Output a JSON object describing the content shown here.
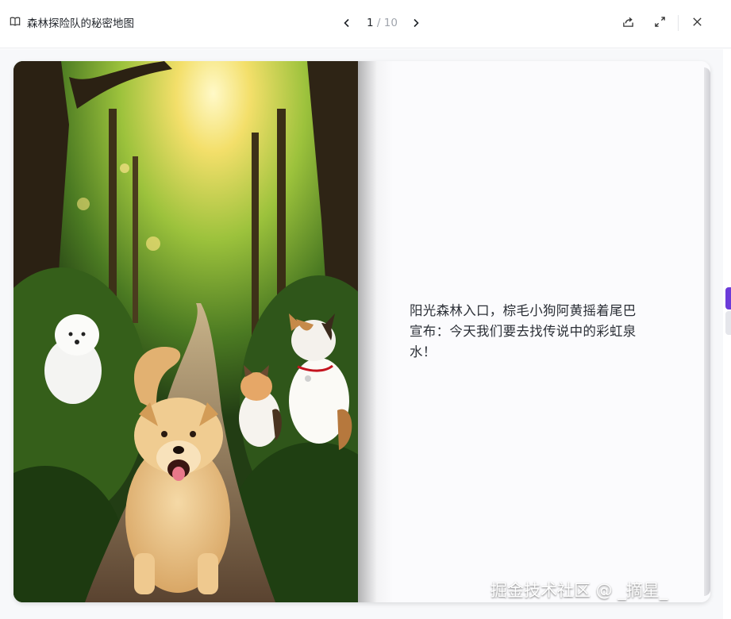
{
  "header": {
    "book_icon": "book-open-icon",
    "title": "森林探险队的秘密地图",
    "pager": {
      "current": "1",
      "separator": "/",
      "total": "10"
    },
    "prev_icon": "chevron-left-icon",
    "next_icon": "chevron-right-icon",
    "tools": {
      "share_icon": "share-icon",
      "fullscreen_icon": "fullscreen-icon",
      "close_icon": "close-icon"
    }
  },
  "page": {
    "illustration": "forest-path-with-dog-and-cats-illustration",
    "story_text": "阳光森林入口，棕毛小狗阿黄摇着尾巴宣布：今天我们要去找传说中的彩虹泉水！"
  },
  "watermark": "掘金技术社区 @ _摘星_",
  "colors": {
    "accent": "#6b3bd9",
    "text": "#1f2329",
    "muted": "#a0a5ad"
  }
}
